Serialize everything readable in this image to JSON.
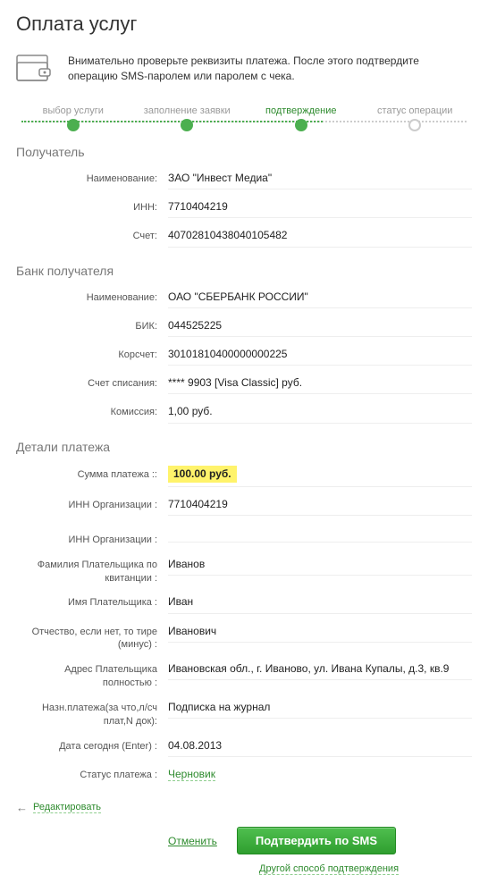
{
  "page": {
    "title": "Оплата услуг",
    "notice": "Внимательно проверьте реквизиты платежа. После этого подтвердите операцию SMS-паролем или паролем с чека."
  },
  "stepper": {
    "step1": "выбор услуги",
    "step2": "заполнение заявки",
    "step3": "подтверждение",
    "step4": "статус операции"
  },
  "sections": {
    "recipient_heading": "Получатель",
    "bank_heading": "Банк получателя",
    "details_heading": "Детали платежа"
  },
  "recipient": {
    "name_label": "Наименование:",
    "name": "ЗАО \"Инвест Медиа\"",
    "inn_label": "ИНН:",
    "inn": "7710404219",
    "account_label": "Счет:",
    "account": "40702810438040105482"
  },
  "bank": {
    "name_label": "Наименование:",
    "name": "ОАО \"СБЕРБАНК РОССИИ\"",
    "bik_label": "БИК:",
    "bik": "044525225",
    "corr_label": "Корсчет:",
    "corr": "30101810400000000225",
    "card_label": "Счет списания:",
    "card": "**** 9903  [Visa Classic]  руб.",
    "fee_label": "Комиссия:",
    "fee": "1,00 руб."
  },
  "details": {
    "amount_label": "Сумма платежа ::",
    "amount": "100.00 руб.",
    "org_inn_label": "ИНН Организации :",
    "org_inn": "7710404219",
    "org_inn2_label": "ИНН Организации :",
    "org_inn2": "",
    "lastname_label": "Фамилия Плательщика по квитанции :",
    "lastname": "Иванов",
    "firstname_label": "Имя Плательщика :",
    "firstname": "Иван",
    "patronymic_label": "Отчество, если нет, то тире (минус) :",
    "patronymic": "Иванович",
    "address_label": "Адрес Плательщика полностью :",
    "address": "Ивановская обл., г. Иваново, ул. Ивана Купалы, д.3, кв.9",
    "purpose_label": "Назн.платежа(за что,л/сч плат,N док):",
    "purpose": "Подписка на журнал",
    "date_label": "Дата сегодня (Enter) :",
    "date": "04.08.2013",
    "status_label": "Статус платежа :",
    "status": "Черновик"
  },
  "actions": {
    "edit": "Редактировать",
    "cancel": "Отменить",
    "confirm_sms": "Подтвердить по SMS",
    "alt_confirm": "Другой способ подтверждения"
  }
}
